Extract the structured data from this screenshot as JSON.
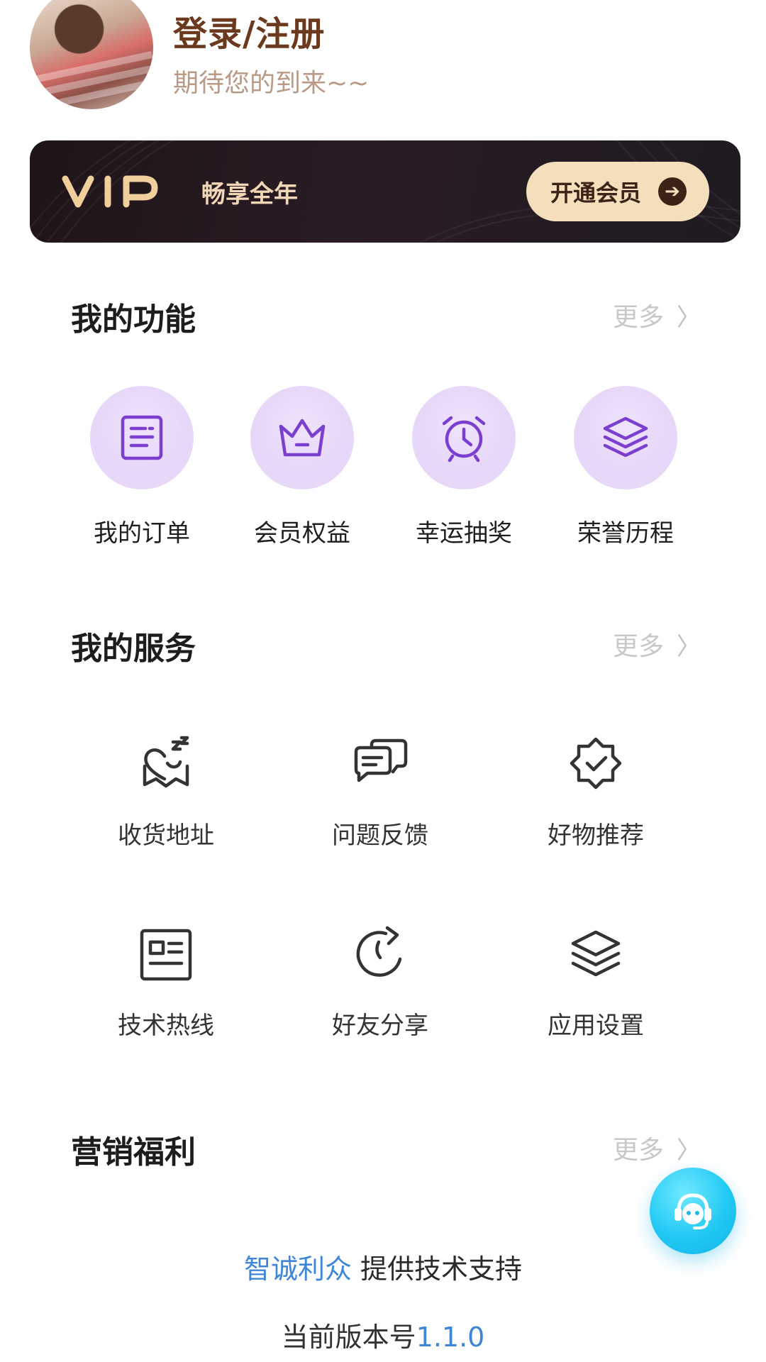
{
  "header": {
    "login_title": "登录/注册",
    "login_subtitle": "期待您的到来~~"
  },
  "vip": {
    "logo_text": "VIP",
    "tagline": "畅享全年",
    "button_label": "开通会员",
    "colors": {
      "bg": "#1e1519",
      "gold": "#f4dfbd",
      "text": "#f1d7b6"
    }
  },
  "functions": {
    "title": "我的功能",
    "more": "更多",
    "items": [
      {
        "label": "我的订单",
        "icon": "order-list-icon"
      },
      {
        "label": "会员权益",
        "icon": "crown-icon"
      },
      {
        "label": "幸运抽奖",
        "icon": "alarm-clock-icon"
      },
      {
        "label": "荣誉历程",
        "icon": "layers-icon"
      }
    ]
  },
  "services": {
    "title": "我的服务",
    "more": "更多",
    "items": [
      {
        "label": "收货地址",
        "icon": "sleep-heart-icon"
      },
      {
        "label": "问题反馈",
        "icon": "chat-bubbles-icon"
      },
      {
        "label": "好物推荐",
        "icon": "badge-check-icon"
      },
      {
        "label": "技术热线",
        "icon": "id-card-icon"
      },
      {
        "label": "好友分享",
        "icon": "share-arrow-icon"
      },
      {
        "label": "应用设置",
        "icon": "layers-icon"
      }
    ]
  },
  "marketing": {
    "title": "营销福利",
    "more": "更多"
  },
  "footer": {
    "brand": "智诚利众",
    "support_text": " 提供技术支持",
    "version_label": "当前版本号",
    "version_number": "1.1.0"
  },
  "accent_color": "#7b3fd0",
  "link_color": "#3f86d6"
}
